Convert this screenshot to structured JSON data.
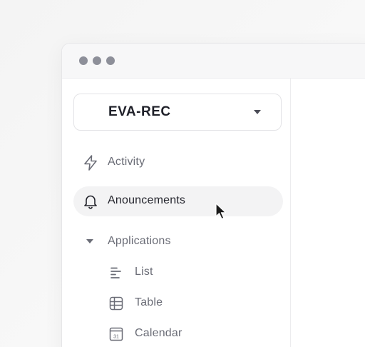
{
  "window": {
    "controls": [
      "dot",
      "dot",
      "dot"
    ]
  },
  "workspace": {
    "name": "EVA-REC",
    "icon": "chevron-down-icon"
  },
  "nav": {
    "activity": {
      "label": "Activity",
      "icon": "lightning-icon"
    },
    "announcements": {
      "label": "Anouncements",
      "icon": "bell-icon",
      "active": true
    },
    "applications": {
      "label": "Applications",
      "expanded": true,
      "items": [
        {
          "label": "List",
          "icon": "list-icon"
        },
        {
          "label": "Table",
          "icon": "table-icon"
        },
        {
          "label": "Calendar",
          "icon": "calendar-icon",
          "icon_text": "31"
        }
      ]
    }
  },
  "colors": {
    "accent_text": "#24252d",
    "muted_text": "#6a6c76",
    "active_bg": "#f3f3f4"
  }
}
